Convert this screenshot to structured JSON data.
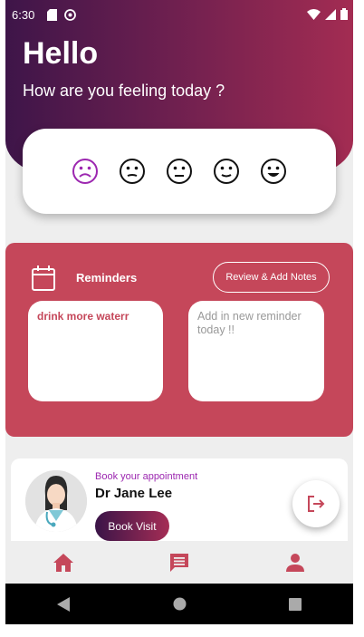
{
  "status_bar": {
    "time": "6:30"
  },
  "header": {
    "greeting": "Hello",
    "question": "How are you feeling today ?"
  },
  "moods": [
    {
      "name": "sad",
      "selected": true
    },
    {
      "name": "neutral",
      "selected": false
    },
    {
      "name": "neutral",
      "selected": false
    },
    {
      "name": "slight-smile",
      "selected": false
    },
    {
      "name": "happy",
      "selected": false
    }
  ],
  "reminders": {
    "title": "Reminders",
    "review_button": "Review & Add Notes",
    "note_text": "drink more waterr",
    "new_placeholder": "Add in new reminder today !!"
  },
  "appointment": {
    "label": "Book your appointment",
    "doctor": "Dr Jane Lee",
    "button": "Book Visit"
  },
  "colors": {
    "accent": "#c5475a",
    "selected_mood": "#9c27b0",
    "header_start": "#3e1549",
    "header_end": "#a32c52"
  },
  "icons": {
    "status": [
      "sd-card-icon",
      "at-sign-icon",
      "wifi-icon",
      "signal-icon",
      "battery-icon"
    ],
    "nav": [
      "home-icon",
      "chat-icon",
      "person-icon"
    ],
    "system": [
      "back-icon",
      "home-circle-icon",
      "recents-icon"
    ]
  }
}
